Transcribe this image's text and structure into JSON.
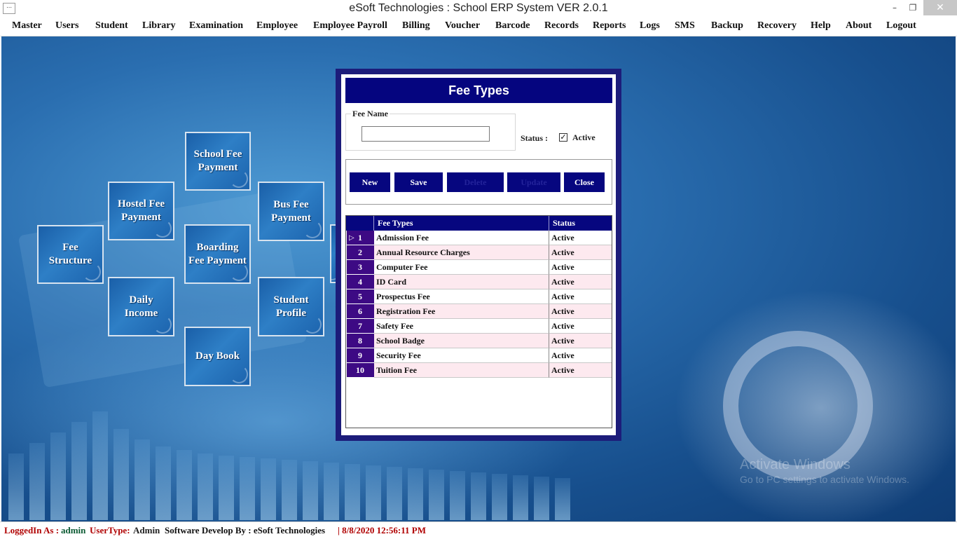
{
  "window": {
    "title": "eSoft Technologies : School ERP System VER 2.0.1",
    "icon": "app-icon",
    "controls": {
      "minimize": "–",
      "maximize": "❐",
      "close": "✕"
    }
  },
  "menu": [
    "Master",
    "Users",
    "Student",
    "Library",
    "Examination",
    "Employee",
    "Employee Payroll",
    "Billing",
    "Voucher",
    "Barcode",
    "Records",
    "Reports",
    "Logs",
    "SMS",
    "Backup",
    "Recovery",
    "Help",
    "About",
    "Logout"
  ],
  "tiles": {
    "fee_structure": "Fee Structure",
    "hostel_fee_payment": "Hostel Fee Payment",
    "school_fee_payment": "School Fee Payment",
    "boarding_fee_payment": "Boarding Fee Payment",
    "bus_fee_payment": "Bus Fee Payment",
    "daily_income": "Daily Income",
    "student_profile": "Student Profile",
    "day_book": "Day Book"
  },
  "dialog": {
    "title": "Fee Types",
    "fee_name_label": "Fee Name",
    "fee_name_value": "",
    "status_label": "Status :",
    "active_checked": true,
    "active_label": "Active",
    "buttons": {
      "new": "New",
      "save": "Save",
      "delete": "Delete",
      "update": "Update",
      "close": "Close"
    },
    "grid": {
      "headers": [
        "",
        "Fee Types",
        "Status"
      ],
      "rows": [
        {
          "no": "1",
          "name": "Admission Fee",
          "status": "Active"
        },
        {
          "no": "2",
          "name": "Annual Resource Charges",
          "status": "Active"
        },
        {
          "no": "3",
          "name": "Computer Fee",
          "status": "Active"
        },
        {
          "no": "4",
          "name": "ID Card",
          "status": "Active"
        },
        {
          "no": "5",
          "name": "Prospectus Fee",
          "status": "Active"
        },
        {
          "no": "6",
          "name": "Registration Fee",
          "status": "Active"
        },
        {
          "no": "7",
          "name": "Safety Fee",
          "status": "Active"
        },
        {
          "no": "8",
          "name": "School Badge",
          "status": "Active"
        },
        {
          "no": "9",
          "name": "Security Fee",
          "status": "Active"
        },
        {
          "no": "10",
          "name": "Tuition Fee",
          "status": "Active"
        }
      ]
    }
  },
  "watermark": {
    "line1": "Activate Windows",
    "line2": "Go to PC settings to activate Windows."
  },
  "statusbar": {
    "logged_in_label": "LoggedIn As :",
    "logged_in_value": "admin",
    "usertype_label": "UserType:",
    "usertype_value": "Admin",
    "developer": "Software Develop By : eSoft Technologies",
    "datetime": "| 8/8/2020 12:56:11 PM"
  },
  "colors": {
    "dialog_header": "#05057f",
    "row_number_bg": "#3d0a84",
    "row_alt_bg": "#fde9ef",
    "status_label": "#b00000",
    "status_value": "#0a5a32"
  }
}
